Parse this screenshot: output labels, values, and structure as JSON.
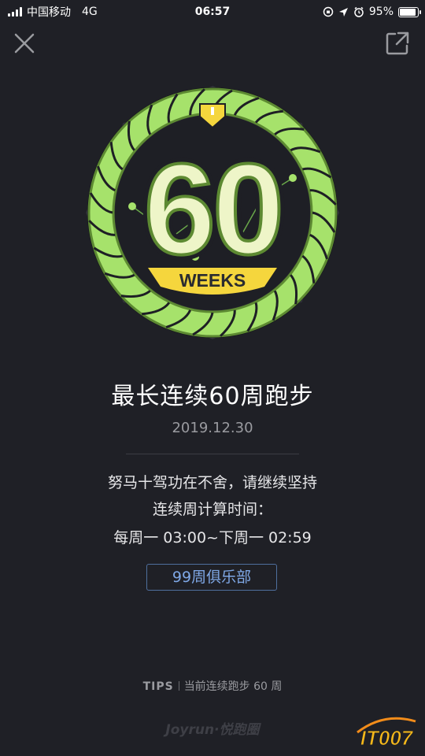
{
  "status_bar": {
    "carrier": "中国移动",
    "network": "4G",
    "time": "06:57",
    "battery_percent": "95%",
    "battery_level": 0.95
  },
  "badge": {
    "number": "60",
    "unit": "WEEKS",
    "ring_color": "#a6e26b",
    "banner_color": "#f5d63d"
  },
  "main": {
    "title": "最长连续60周跑步",
    "date": "2019.12.30",
    "message_1": "努马十驾功在不舍，请继续坚持",
    "message_2": "连续周计算时间：",
    "message_3": "每周一 03:00~下周一 02:59",
    "club_button": "99周俱乐部"
  },
  "footer": {
    "tips_label": "TIPS",
    "tips_text": "当前连续跑步 60 周",
    "brand": "Joyrun·悦跑圈",
    "watermark": "IT007"
  },
  "colors": {
    "background": "#1f2026",
    "accent_blue": "#7fa8e6"
  }
}
